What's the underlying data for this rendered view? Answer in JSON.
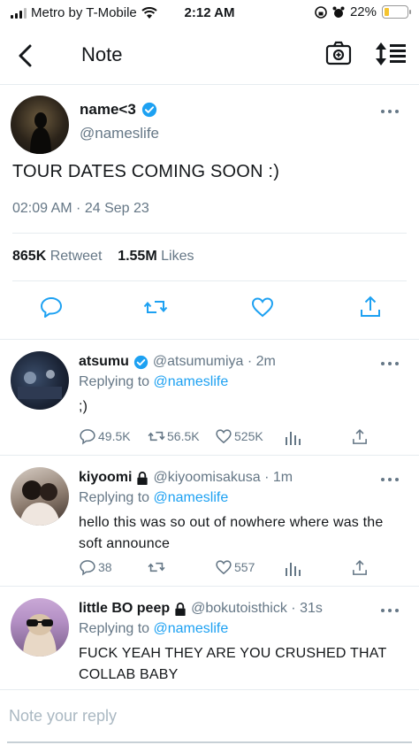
{
  "status_bar": {
    "carrier": "Metro by T-Mobile",
    "time": "2:12 AM",
    "battery": "22%",
    "battery_level": 0.22
  },
  "header": {
    "title": "Note",
    "icons": [
      "back-arrow-icon",
      "camera-icon",
      "sort-icon"
    ]
  },
  "main_tweet": {
    "name": "name<3",
    "handle": "@nameslife",
    "text": "TOUR DATES COMING SOON :)",
    "timestamp": "02:09 AM · 24 Sep 23",
    "retweets_count": "865K",
    "retweets_label": "Retweet",
    "likes_count": "1.55M",
    "likes_label": "Likes"
  },
  "replies": [
    {
      "name": "atsumu",
      "verified": true,
      "handle_time": "@atsumumiya · 2m",
      "replying_prefix": "Replying to",
      "replying_to": "@nameslife",
      "text": ";)",
      "reply_count": "49.5K",
      "retweet_count": "56.5K",
      "like_count": "525K"
    },
    {
      "name": "kiyoomi",
      "locked": true,
      "handle_time": "@kiyoomisakusa · 1m",
      "replying_prefix": "Replying to",
      "replying_to": "@nameslife",
      "text": "hello this was so out of nowhere where was the soft announce",
      "reply_count": "38",
      "retweet_count": "",
      "like_count": "557"
    },
    {
      "name": "little BO peep",
      "locked": true,
      "handle_time": "@bokutoisthick · 31s",
      "replying_prefix": "Replying to",
      "replying_to": "@nameslife",
      "text": "FUCK YEAH THEY ARE YOU CRUSHED THAT COLLAB BABY"
    }
  ],
  "compose": {
    "placeholder": "Note your reply"
  },
  "colors": {
    "accent": "#1da1f2",
    "text": "#14171a",
    "muted": "#657786",
    "divider": "#e6ecf0"
  }
}
